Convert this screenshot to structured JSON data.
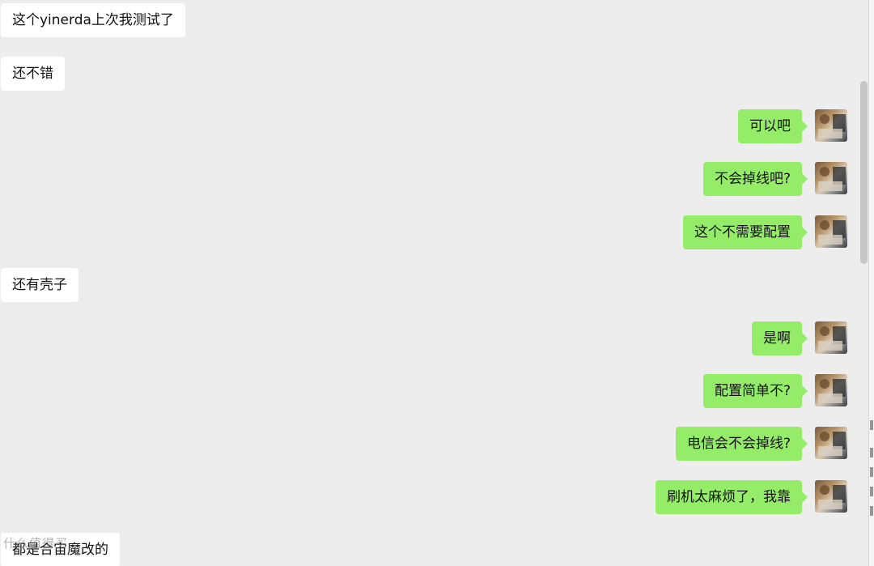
{
  "messages": [
    {
      "side": "left",
      "text": "这个yinerda上次我测试了"
    },
    {
      "side": "left",
      "text": "还不错"
    },
    {
      "side": "right",
      "text": "可以吧"
    },
    {
      "side": "right",
      "text": "不会掉线吧?"
    },
    {
      "side": "right",
      "text": "这个不需要配置"
    },
    {
      "side": "left",
      "text": "还有壳子"
    },
    {
      "side": "right",
      "text": "是啊"
    },
    {
      "side": "right",
      "text": "配置简单不?"
    },
    {
      "side": "right",
      "text": "电信会不会掉线?"
    },
    {
      "side": "right",
      "text": "刷机太麻烦了，我靠"
    },
    {
      "side": "left",
      "text": "都是合宙魔改的"
    }
  ],
  "watermark": "什么值得买",
  "colors": {
    "background": "#ededed",
    "incoming_bubble": "#ffffff",
    "outgoing_bubble": "#95ec69"
  }
}
